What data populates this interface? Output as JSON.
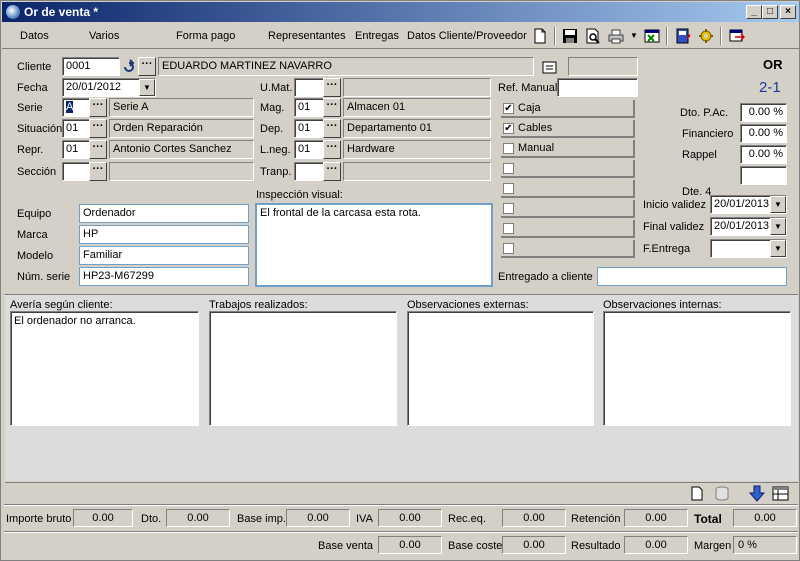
{
  "window": {
    "title": "Or de venta *"
  },
  "menu": [
    "Datos",
    "Varios",
    "Forma pago",
    "Representantes",
    "Entregas",
    "Datos Cliente/Proveedor"
  ],
  "toolbar_icons": [
    "new-document-icon",
    "save-icon",
    "print-preview-icon",
    "printer-icon",
    "excel-export-icon",
    "notebook-icon",
    "settings-gear-icon",
    "exit-icon"
  ],
  "header": {
    "doc_type": "OR",
    "doc_number": "2-1",
    "cliente_label": "Cliente",
    "cliente_code": "0001",
    "cliente_name": "EDUARDO MARTINEZ NAVARRO",
    "fecha_label": "Fecha",
    "fecha": "20/01/2012",
    "serie_label": "Serie",
    "serie_code": "A",
    "serie_name": "Serie A",
    "situacion_label": "Situación",
    "situacion_code": "01",
    "situacion_name": "Orden Reparación",
    "repr_label": "Repr.",
    "repr_code": "01",
    "repr_name": "Antonio Cortes Sanchez",
    "seccion_label": "Sección",
    "umat_label": "U.Mat.",
    "mag_label": "Mag.",
    "mag_code": "01",
    "mag_name": "Almacen 01",
    "dep_label": "Dep.",
    "dep_code": "01",
    "dep_name": "Departamento 01",
    "lneg_label": "L.neg.",
    "lneg_code": "01",
    "lneg_name": "Hardware",
    "tranp_label": "Tranp.",
    "ref_manual_label": "Ref. Manual"
  },
  "checklist": [
    {
      "label": "Caja",
      "checked": true
    },
    {
      "label": "Cables",
      "checked": true
    },
    {
      "label": "Manual",
      "checked": false
    },
    {
      "label": "",
      "checked": false
    },
    {
      "label": "",
      "checked": false
    },
    {
      "label": "",
      "checked": false
    },
    {
      "label": "",
      "checked": false
    },
    {
      "label": "",
      "checked": false
    }
  ],
  "discounts": {
    "dto_pac_label": "Dto. P.Ac.",
    "dto_pac": "0.00 %",
    "financiero_label": "Financiero",
    "financiero": "0.00 %",
    "rappel_label": "Rappel",
    "rappel": "0.00 %",
    "dte4_label": "Dte. 4"
  },
  "validity": {
    "inicio_label": "Inicio validez",
    "inicio": "20/01/2013",
    "final_label": "Final validez",
    "final": "20/01/2013",
    "fentrega_label": "F.Entrega"
  },
  "equipo": {
    "equipo_label": "Equipo",
    "equipo": "Ordenador",
    "marca_label": "Marca",
    "marca": "HP",
    "modelo_label": "Modelo",
    "modelo": "Familiar",
    "num_serie_label": "Núm. serie",
    "num_serie": "HP23-M67299",
    "inspeccion_label": "Inspección visual:",
    "inspeccion": "El frontal de la carcasa esta rota.",
    "entregado_label": "Entregado a cliente"
  },
  "panels": {
    "averia_label": "Avería según cliente:",
    "averia": "El ordenador no arranca.",
    "trabajos_label": "Trabajos realizados:",
    "trabajos": "",
    "obs_ext_label": "Observaciones externas:",
    "obs_ext": "",
    "obs_int_label": "Observaciones internas:",
    "obs_int": ""
  },
  "totals": {
    "importe_bruto_label": "Importe bruto",
    "importe_bruto": "0.00",
    "dto_label": "Dto.",
    "dto": "0.00",
    "base_imp_label": "Base imp.",
    "base_imp": "0.00",
    "iva_label": "IVA",
    "iva": "0.00",
    "rec_eq_label": "Rec.eq.",
    "rec_eq": "0.00",
    "retencion_label": "Retención",
    "retencion": "0.00",
    "total_label": "Total",
    "total": "0.00",
    "base_venta_label": "Base venta",
    "base_venta": "0.00",
    "base_coste_label": "Base coste",
    "base_coste": "0.00",
    "resultado_label": "Resultado",
    "resultado": "0.00",
    "margen_label": "Margen",
    "margen": "0 %"
  }
}
